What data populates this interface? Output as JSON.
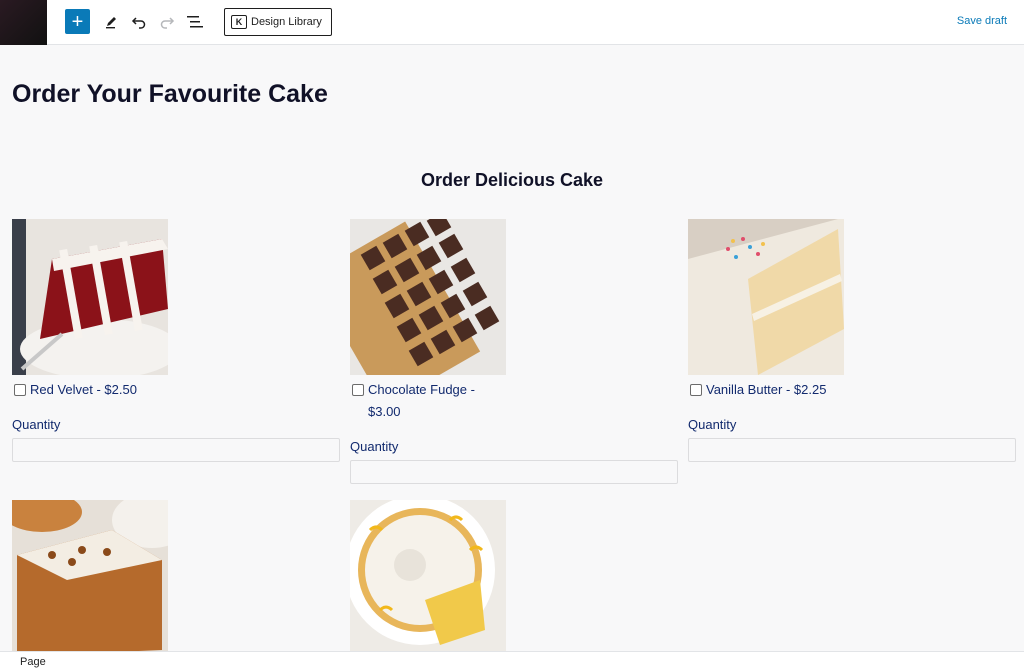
{
  "toolbar": {
    "inserter_glyph": "+",
    "design_library_label": "Design Library",
    "design_library_logo": "K",
    "save_draft_label": "Save draft"
  },
  "page": {
    "title": "Order Your Favourite Cake",
    "section_title": "Order Delicious Cake"
  },
  "products": [
    {
      "label": "Red Velvet - $2.50",
      "quantity_label": "Quantity",
      "quantity_value": ""
    },
    {
      "label": "Chocolate Fudge - $3.00",
      "quantity_label": "Quantity",
      "quantity_value": ""
    },
    {
      "label": "Vanilla Butter - $2.25",
      "quantity_label": "Quantity",
      "quantity_value": ""
    },
    {
      "label": "",
      "quantity_label": "",
      "quantity_value": ""
    },
    {
      "label": "",
      "quantity_label": "",
      "quantity_value": ""
    }
  ],
  "statusbar": {
    "label": "Page"
  },
  "colors": {
    "accent": "#0a7ab8",
    "heading": "#101127",
    "label_text": "#122a6e"
  },
  "icons": [
    "plus-icon",
    "pen-icon",
    "undo-icon",
    "redo-icon",
    "list-view-icon"
  ]
}
